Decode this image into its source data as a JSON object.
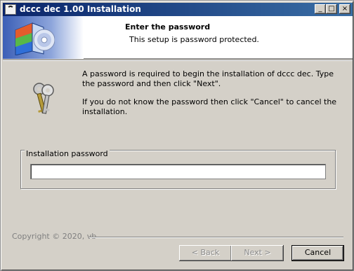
{
  "window": {
    "title": "dccc dec 1.00 Installation",
    "controls": {
      "minimize": "_",
      "maximize": "□",
      "close": "×"
    }
  },
  "header": {
    "title": "Enter the password",
    "subtitle": "This setup is password protected."
  },
  "body": {
    "message1": "A password is required to begin the installation of dccc dec. Type the password and then click \"Next\".",
    "message2": "If you do not know the password then click \"Cancel\" to cancel the installation."
  },
  "password_group": {
    "label": "Installation password",
    "value": ""
  },
  "footer": {
    "copyright": "Copyright © 2020, vb",
    "back_label": "< Back",
    "next_label": "Next >",
    "cancel_label": "Cancel"
  },
  "icons": {
    "app": "wifi-app-icon",
    "installer": "cd-box-icon",
    "keys": "keys-icon"
  },
  "colors": {
    "title_bar": "#0a246a",
    "face": "#d4d0c8"
  }
}
